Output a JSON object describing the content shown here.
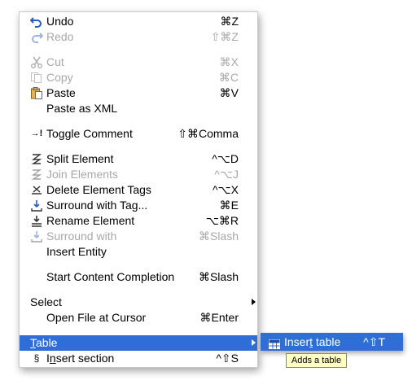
{
  "menu": {
    "items": [
      {
        "label": "Undo",
        "shortcut": "⌘Z",
        "icon": "undo-icon"
      },
      {
        "label": "Redo",
        "shortcut": "⇧⌘Z",
        "icon": "redo-icon",
        "disabled": true
      },
      {
        "label": "Cut",
        "shortcut": "⌘X",
        "icon": "cut-icon",
        "disabled": true
      },
      {
        "label": "Copy",
        "shortcut": "⌘C",
        "icon": "copy-icon",
        "disabled": true
      },
      {
        "label": "Paste",
        "shortcut": "⌘V",
        "icon": "paste-icon"
      },
      {
        "label": "Paste as XML",
        "shortcut": ""
      },
      {
        "label": "Toggle Comment",
        "shortcut": "⇧⌘Comma",
        "icon": "toggle-comment-icon"
      },
      {
        "label": "Split Element",
        "shortcut": "^⌥D",
        "icon": "split-element-icon"
      },
      {
        "label": "Join Elements",
        "shortcut": "^⌥J",
        "icon": "join-elements-icon",
        "disabled": true
      },
      {
        "label": "Delete Element Tags",
        "shortcut": "^⌥X",
        "icon": "delete-tags-icon"
      },
      {
        "label": "Surround with Tag...",
        "shortcut": "⌘E",
        "icon": "surround-tag-icon"
      },
      {
        "label": "Rename Element",
        "shortcut": "⌥⌘R",
        "icon": "rename-element-icon"
      },
      {
        "label": "Surround with",
        "shortcut": "⌘Slash",
        "icon": "surround-with-icon",
        "disabled": true
      },
      {
        "label": "Insert Entity",
        "shortcut": ""
      },
      {
        "label": "Start Content Completion",
        "shortcut": "⌘Slash"
      },
      {
        "label": "Select",
        "shortcut": ""
      },
      {
        "label": "Open File at Cursor",
        "shortcut": "⌘Enter"
      },
      {
        "label_pre": "",
        "label_u": "T",
        "label_post": "able"
      },
      {
        "label_pre": "I",
        "label_u": "n",
        "label_post": "sert section",
        "shortcut": "^⇧S"
      }
    ]
  },
  "submenu": {
    "label_pre": "Inser",
    "label_u": "t",
    "label_post": " table",
    "shortcut": "^⇧T",
    "icon": "table-icon"
  },
  "tooltip": {
    "text": "Adds a table"
  },
  "colors": {
    "highlight": "#2f6ed6",
    "disabled_text": "#a8a8a8",
    "tooltip_bg": "#ffffc4"
  }
}
